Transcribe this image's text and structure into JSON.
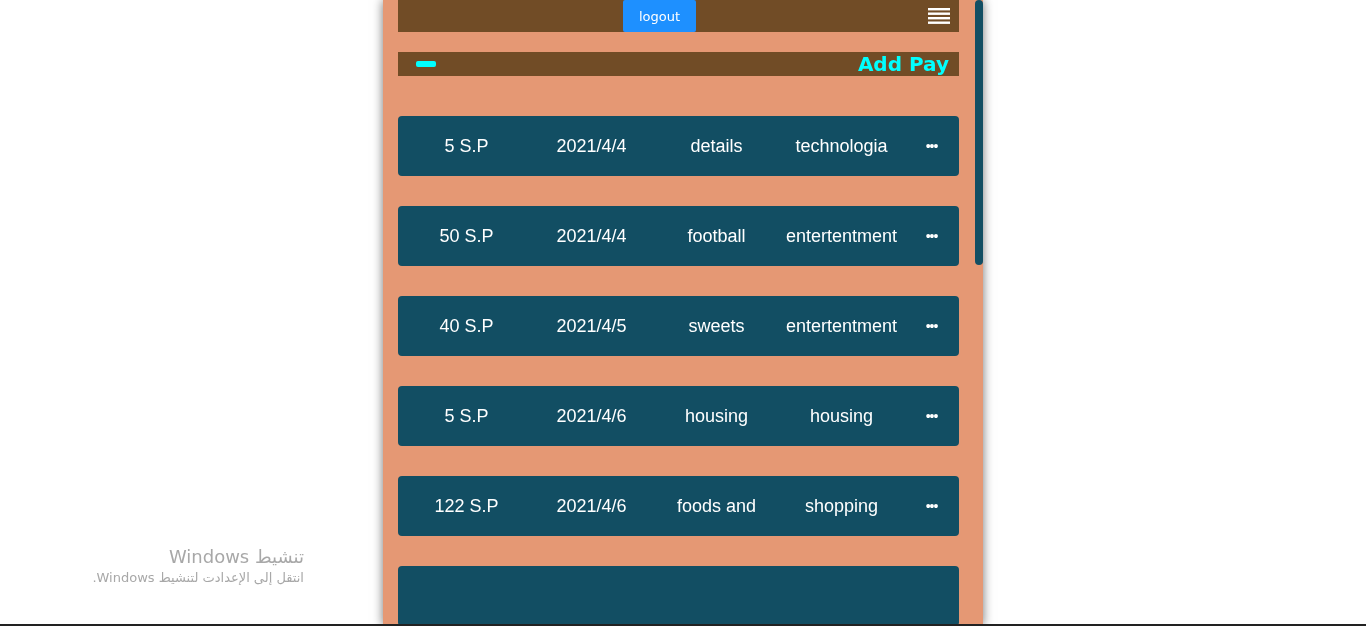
{
  "header": {
    "logout_button": "logout"
  },
  "add_bar": {
    "label": "Add Pay"
  },
  "payments": [
    {
      "kind": "entry",
      "amount": "5 S.P",
      "date": "2021/4/4",
      "details": "details",
      "category": "technologia",
      "more": "•••"
    },
    {
      "kind": "entry",
      "amount": "50 S.P",
      "date": "2021/4/4",
      "details": "football",
      "category": "entertentment",
      "more": "•••"
    },
    {
      "kind": "entry",
      "amount": "40 S.P",
      "date": "2021/4/5",
      "details": "sweets",
      "category": "entertentment",
      "more": "•••"
    },
    {
      "kind": "entry",
      "amount": "5 S.P",
      "date": "2021/4/6",
      "details": "housing",
      "category": "housing",
      "more": "•••"
    },
    {
      "kind": "entry",
      "amount": "122 S.P",
      "date": "2021/4/6",
      "details": "foods and",
      "category": "shopping",
      "more": "•••"
    },
    {
      "kind": "cut"
    }
  ],
  "os_notice": {
    "title": "تنشيط Windows",
    "message": "انتقل إلى الإعدادت لتنشيط Windows."
  }
}
